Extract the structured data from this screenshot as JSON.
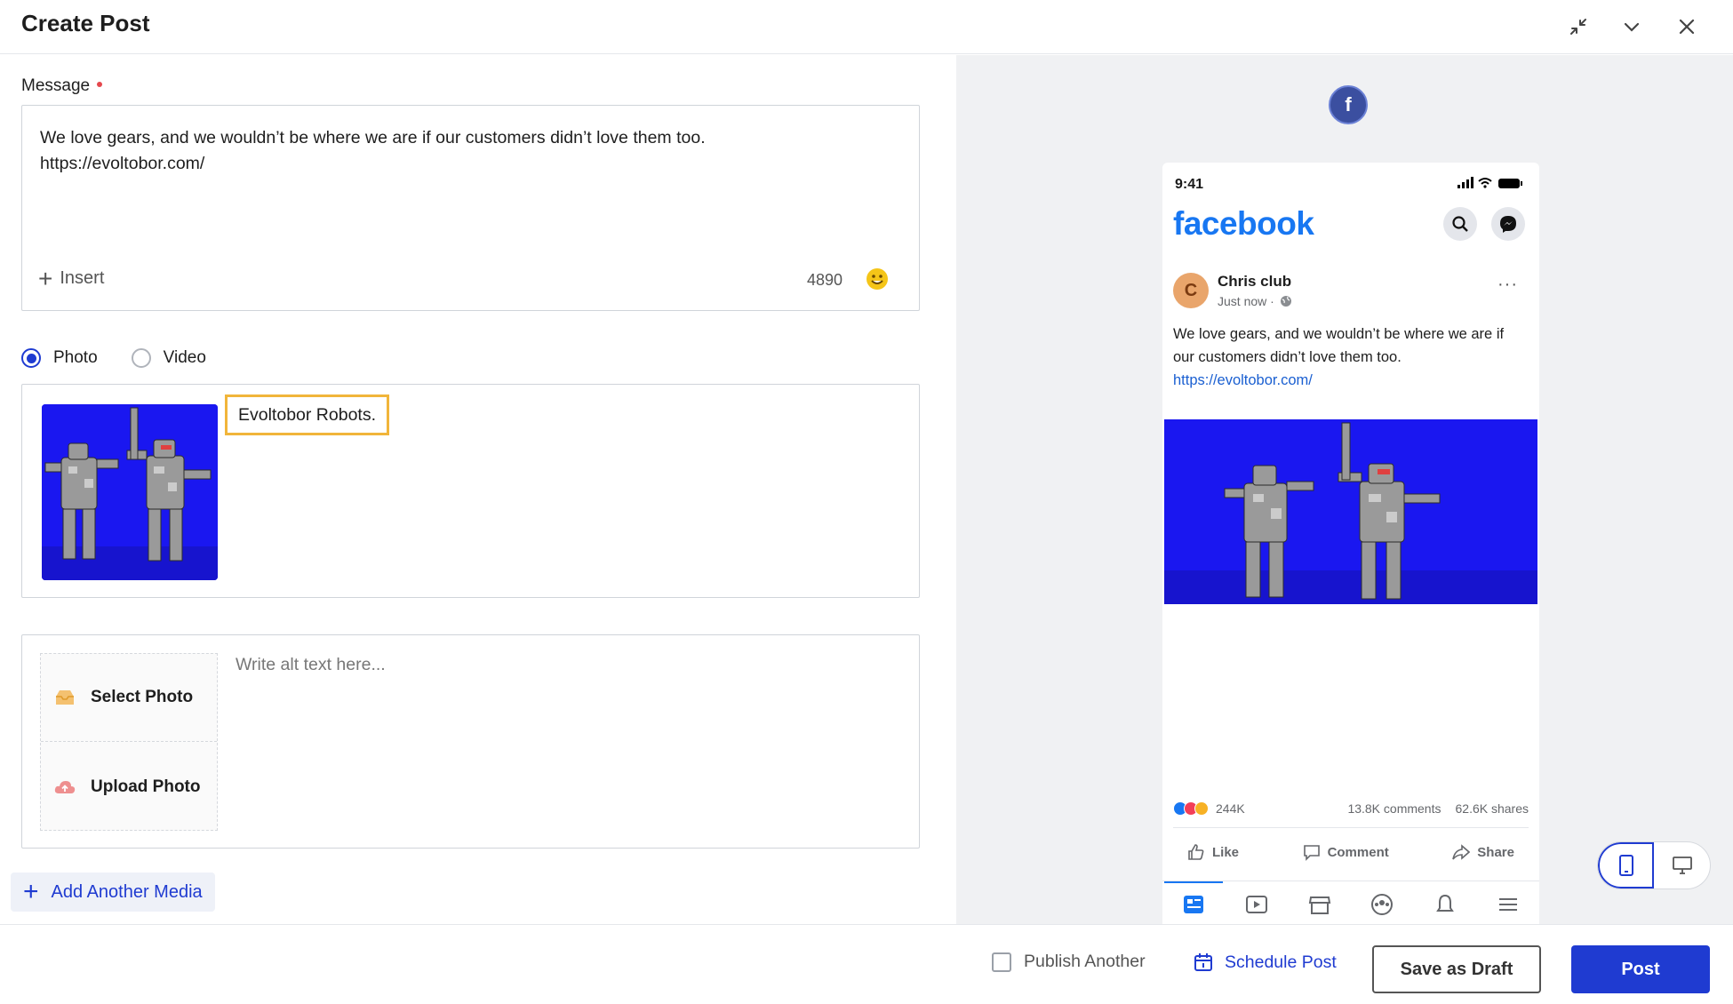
{
  "header": {
    "title": "Create Post"
  },
  "message": {
    "label": "Message",
    "text": "We love gears, and we wouldn’t be where we are if our customers didn’t love them too.\nhttps://evoltobor.com/",
    "insert_label": "Insert",
    "char_count": "4890"
  },
  "media_type": {
    "options": [
      "Photo",
      "Video"
    ],
    "selected": "Photo"
  },
  "media": {
    "caption": "Evoltobor Robots."
  },
  "alt": {
    "select_label": "Select Photo",
    "upload_label": "Upload Photo",
    "placeholder": "Write alt text here..."
  },
  "add_media_label": "Add Another Media",
  "preview": {
    "network_icon": "facebook-icon",
    "status_time": "9:41",
    "logo_text": "facebook",
    "page_name": "Chris club",
    "post_time": "Just now ·",
    "post_text": "We love gears, and we wouldn’t be where we are if our customers didn’t love them too.",
    "post_link": "https://evoltobor.com/",
    "avatar_letter": "C",
    "reactions_count": "244K",
    "comments_count": "13.8K comments",
    "shares_count": "62.6K shares",
    "actions": [
      "Like",
      "Comment",
      "Share"
    ]
  },
  "footer": {
    "publish_another": "Publish Another",
    "schedule": "Schedule Post",
    "save_draft": "Save as Draft",
    "post": "Post"
  },
  "colors": {
    "accent": "#1f3bd1",
    "facebook_blue": "#1877f2",
    "caption_border": "#f1b53a",
    "robot_bg": "#1a17f0"
  }
}
